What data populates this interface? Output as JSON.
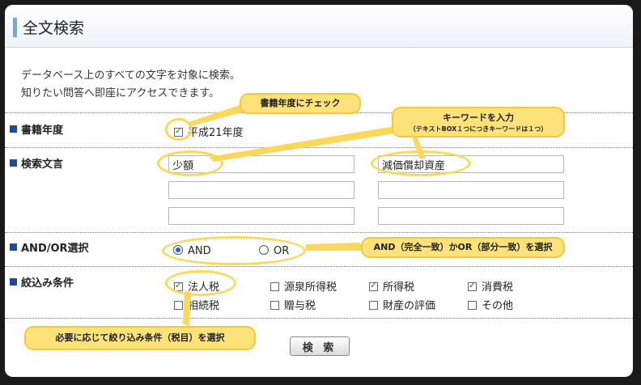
{
  "header": {
    "title": "全文検索"
  },
  "description": {
    "line1": "データベース上のすべての文字を対象に検索。",
    "line2": "知りたい問答へ即座にアクセスできます。"
  },
  "sections": {
    "year": {
      "label": "書籍年度",
      "option": "平成21年度",
      "checked": true
    },
    "keywords": {
      "label": "検索文言",
      "values": [
        "少額",
        "",
        "",
        "減価償却資産",
        "",
        ""
      ]
    },
    "andor": {
      "label": "AND/OR選択",
      "options": [
        "AND",
        "OR"
      ],
      "selected": "AND"
    },
    "filter": {
      "label": "絞込み条件",
      "options": [
        {
          "label": "法人税",
          "checked": true
        },
        {
          "label": "源泉所得税",
          "checked": false
        },
        {
          "label": "所得税",
          "checked": true
        },
        {
          "label": "消費税",
          "checked": true
        },
        {
          "label": "相続税",
          "checked": false
        },
        {
          "label": "贈与税",
          "checked": false
        },
        {
          "label": "財産の評価",
          "checked": false
        },
        {
          "label": "その他",
          "checked": false
        }
      ]
    }
  },
  "search_button": "検 索",
  "callouts": {
    "year": "書籍年度にチェック",
    "keyword_main": "キーワードを入力",
    "keyword_sub": "（テキストBOX１つにつきキーワードは１つ）",
    "andor": "AND（完全一致）かOR（部分一致）を選択",
    "filter": "必要に応じて絞り込み条件（税目）を選択"
  },
  "colors": {
    "accent": "#1e4c98",
    "callout": "#fde27a",
    "callout_border": "#f4c83d",
    "check": "#168a2f"
  }
}
